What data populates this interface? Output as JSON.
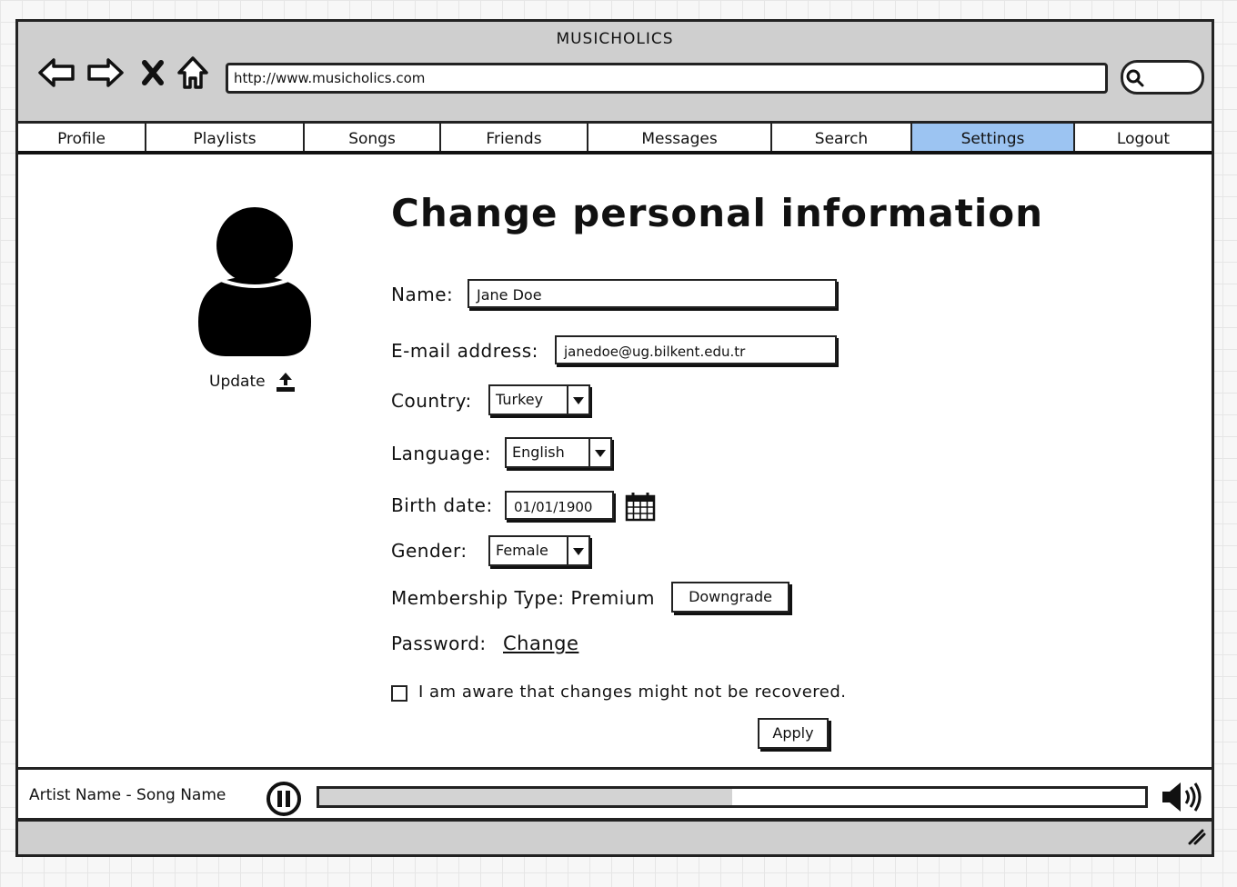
{
  "window": {
    "title": "MUSICHOLICS"
  },
  "browser": {
    "url": "http://www.musicholics.com"
  },
  "tabs": [
    {
      "label": "Profile",
      "active": false
    },
    {
      "label": "Playlists",
      "active": false
    },
    {
      "label": "Songs",
      "active": false
    },
    {
      "label": "Friends",
      "active": false
    },
    {
      "label": "Messages",
      "active": false
    },
    {
      "label": "Search",
      "active": false
    },
    {
      "label": "Settings",
      "active": true
    },
    {
      "label": "Logout",
      "active": false
    }
  ],
  "profile": {
    "update_label": "Update"
  },
  "form": {
    "heading": "Change personal information",
    "name_label": "Name:",
    "name_value": "Jane Doe",
    "email_label": "E-mail address:",
    "email_value": "janedoe@ug.bilkent.edu.tr",
    "country_label": "Country:",
    "country_value": "Turkey",
    "language_label": "Language:",
    "language_value": "English",
    "birth_label": "Birth date:",
    "birth_value": "01/01/1900",
    "gender_label": "Gender:",
    "gender_value": "Female",
    "membership_label": "Membership Type: Premium",
    "downgrade_label": "Downgrade",
    "password_label": "Password:",
    "password_change_label": "Change",
    "aware_label": "I am aware that changes might not be recovered.",
    "apply_label": "Apply"
  },
  "player": {
    "now_playing": "Artist Name - Song Name",
    "progress": 0.5
  },
  "colors": {
    "active_tab": "#9cc4f2",
    "chrome": "#cfcfcf"
  },
  "icons": [
    "back-arrow-icon",
    "forward-arrow-icon",
    "stop-icon",
    "home-icon",
    "search-icon",
    "user-avatar-icon",
    "upload-icon",
    "calendar-icon",
    "pause-icon",
    "volume-icon",
    "resize-grip-icon"
  ]
}
